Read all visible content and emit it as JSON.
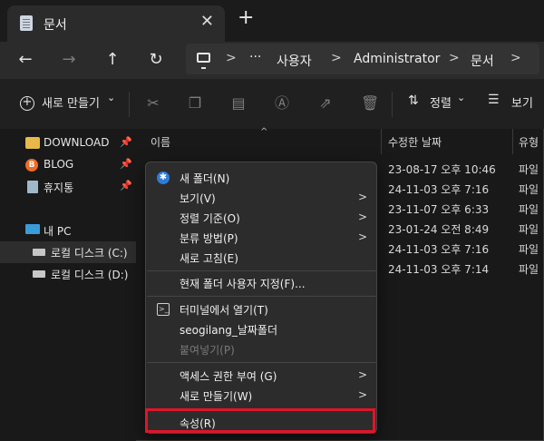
{
  "window": {
    "tab_title": "문서",
    "close_glyph": "✕",
    "new_tab_glyph": "+"
  },
  "nav": {
    "back_glyph": "←",
    "forward_glyph": "→",
    "up_glyph": "↑",
    "refresh_glyph": "↻",
    "breadcrumbs": [
      "사용자",
      "Administrator",
      "문서"
    ],
    "more_glyph": "···",
    "separator_glyph": ">"
  },
  "toolbar": {
    "new_label": "새로 만들기",
    "sort_label": "정렬",
    "view_label": "보기",
    "dropdown_glyph": "⌄"
  },
  "sidebar": {
    "items": [
      {
        "label": "DOWNLOAD",
        "icon": "folder-icon",
        "pinned": true
      },
      {
        "label": "BLOG",
        "icon": "blog-icon",
        "pinned": true
      },
      {
        "label": "휴지통",
        "icon": "recycle-bin-icon",
        "pinned": true
      },
      {
        "label": "내 PC",
        "icon": "pc-icon",
        "pinned": false
      },
      {
        "label": "로컬 디스크 (C:)",
        "icon": "drive-icon",
        "pinned": false
      },
      {
        "label": "로컬 디스크 (D:)",
        "icon": "drive-icon",
        "pinned": false
      }
    ],
    "pin_glyph": "📌"
  },
  "filelist": {
    "columns": [
      "이름",
      "수정한 날짜",
      "유형"
    ],
    "rows": [
      {
        "date": "23-08-17 오후 10:46",
        "type": "파일"
      },
      {
        "date": "24-11-03 오후 7:16",
        "type": "파일"
      },
      {
        "date": "23-11-07 오후 6:33",
        "type": "파일"
      },
      {
        "date": "23-01-24 오전 8:49",
        "type": "파일"
      },
      {
        "date": "24-11-03 오후 7:16",
        "type": "파일"
      },
      {
        "date": "24-11-03 오후 7:14",
        "type": "파일"
      }
    ]
  },
  "context_menu": {
    "arrow_glyph": ">",
    "items": [
      {
        "label": "새 폴더(N)",
        "icon": "new-folder-icon"
      },
      {
        "label": "보기(V)",
        "submenu": true
      },
      {
        "label": "정렬 기준(O)",
        "submenu": true
      },
      {
        "label": "분류 방법(P)",
        "submenu": true
      },
      {
        "label": "새로 고침(E)"
      },
      {
        "label": "현재 폴더 사용자 지정(F)..."
      },
      {
        "label": "터미널에서 열기(T)",
        "icon": "terminal-icon"
      },
      {
        "label": "seogilang_날짜폴더"
      },
      {
        "label": "붙여넣기(P)",
        "disabled": true
      },
      {
        "label": "액세스 권한 부여 (G)",
        "submenu": true
      },
      {
        "label": "새로 만들기(W)",
        "submenu": true
      },
      {
        "label": "속성(R)",
        "highlighted": true
      }
    ]
  },
  "colors": {
    "highlight_border": "#e0142a",
    "accent": "#2f7bd8"
  }
}
